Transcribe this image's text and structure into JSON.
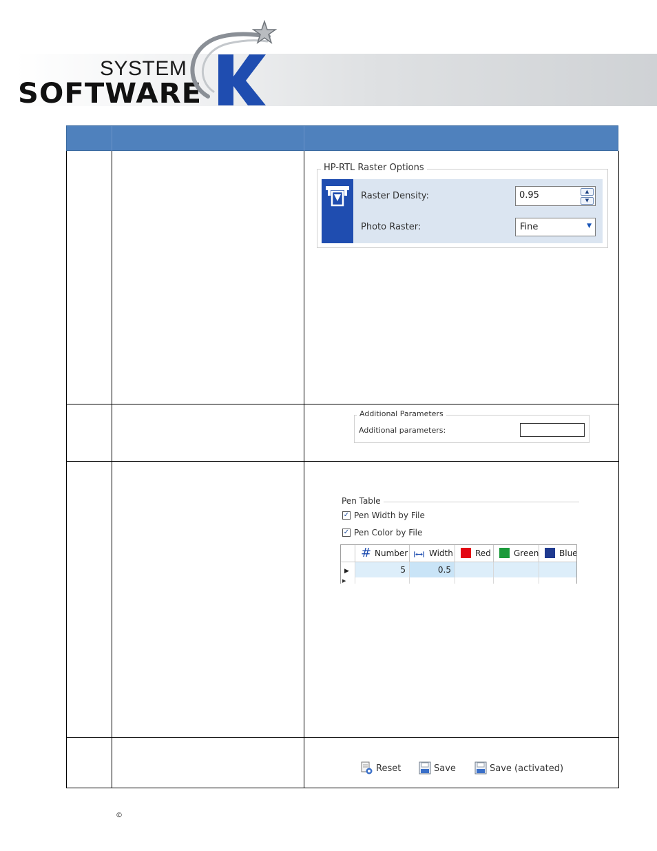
{
  "header": {
    "logo_line1": "SYSTEM",
    "logo_line2": "SOFTWARE",
    "logo_mark": "K"
  },
  "hp_rtl": {
    "title": "HP-RTL Raster Options",
    "icon": "raster-printer-icon",
    "raster_density_label": "Raster Density:",
    "raster_density_value": "0.95",
    "photo_raster_label": "Photo Raster:",
    "photo_raster_value": "Fine",
    "accent_color": "#1f4db0",
    "panel_color": "#dbe5f1"
  },
  "additional_parameters": {
    "title": "Additional Parameters",
    "label": "Additional parameters:",
    "value": ""
  },
  "pen_table": {
    "title": "Pen Table",
    "options": [
      {
        "label": "Pen Width by File",
        "checked": true
      },
      {
        "label": "Pen Color by File",
        "checked": true
      }
    ],
    "columns": [
      {
        "label": "Number",
        "icon": "hash-icon"
      },
      {
        "label": "Width",
        "icon": "width-arrows-icon"
      },
      {
        "label": "Red",
        "color": "#e30613"
      },
      {
        "label": "Green",
        "color": "#1a9a3a"
      },
      {
        "label": "Blue",
        "color": "#1f3a8f"
      }
    ],
    "rows": [
      {
        "number": "5",
        "width": "0.5",
        "red": "",
        "green": "",
        "blue": ""
      }
    ]
  },
  "toolbar": {
    "reset_label": "Reset",
    "save_label": "Save",
    "save_activated_label": "Save (activated)"
  },
  "footer": {
    "copyright_symbol": "©"
  },
  "colors": {
    "table_header": "#4f81bd"
  }
}
